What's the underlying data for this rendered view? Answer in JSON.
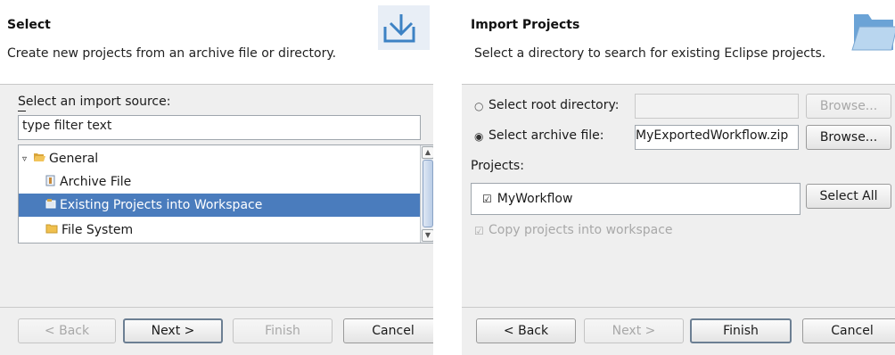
{
  "left": {
    "header": {
      "title": "Select",
      "subtitle": "Create new projects from an archive file or directory.",
      "icon": "import-icon"
    },
    "source_label": "Select an import source:",
    "filter": {
      "value": "type filter text"
    },
    "tree": [
      {
        "label": "General",
        "icon": "folder-open-icon",
        "expanded": true
      },
      {
        "label": "Archive File",
        "icon": "archive-icon"
      },
      {
        "label": "Existing Projects into Workspace",
        "icon": "project-icon",
        "selected": true
      },
      {
        "label": "File System",
        "icon": "folder-icon"
      }
    ],
    "buttons": {
      "back": "< Back",
      "next": "Next >",
      "finish": "Finish",
      "cancel": "Cancel"
    }
  },
  "right": {
    "header": {
      "title": "Import Projects",
      "subtitle": "Select a directory to search for existing Eclipse projects.",
      "icon": "folder-open-icon"
    },
    "root_dir_label": "Select root directory:",
    "root_dir_value": "",
    "archive_label": "Select archive file:",
    "archive_value": "MyExportedWorkflow.zip",
    "browse": "Browse...",
    "projects_label": "Projects:",
    "projects": [
      {
        "label": "MyWorkflow",
        "checked": true
      }
    ],
    "select_all": "Select All",
    "copy_label": "Copy projects into workspace",
    "buttons": {
      "back": "< Back",
      "next": "Next >",
      "finish": "Finish",
      "cancel": "Cancel"
    }
  },
  "colors": {
    "selection": "#4a7cbd",
    "dialog_bg": "#efefef"
  }
}
